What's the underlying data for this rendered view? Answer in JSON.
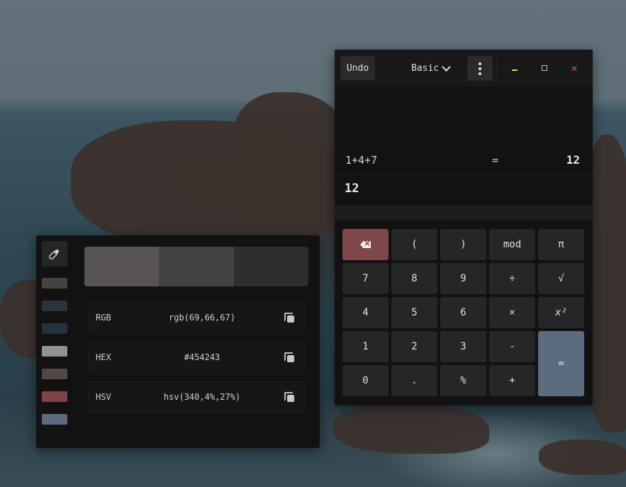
{
  "calculator": {
    "undo_label": "Undo",
    "mode_label": "Basic",
    "history": {
      "expression": "1+4+7",
      "equals": "=",
      "result": "12"
    },
    "current_value": "12",
    "keys": {
      "paren_open": "(",
      "paren_close": ")",
      "mod": "mod",
      "pi": "π",
      "seven": "7",
      "eight": "8",
      "nine": "9",
      "divide": "÷",
      "sqrt": "√",
      "four": "4",
      "five": "5",
      "six": "6",
      "multiply": "×",
      "square": "x²",
      "one": "1",
      "two": "2",
      "three": "3",
      "minus": "-",
      "equals": "=",
      "zero": "0",
      "dot": ".",
      "percent": "%",
      "plus": "+"
    },
    "icons": {
      "backspace": "backspace-icon",
      "menu": "kebab-menu-icon",
      "minimize": "minimize-icon",
      "maximize": "maximize-icon",
      "close": "close-icon",
      "dropdown": "chevron-down-icon"
    }
  },
  "picker": {
    "icons": {
      "eyedropper": "eyedropper-icon",
      "copy": "copy-icon"
    },
    "swatches": [
      "#454243",
      "#2a3340",
      "#26313b",
      "#8f9393",
      "#524844",
      "#7f4445",
      "#5c6b7d"
    ],
    "palette": [
      "#585454",
      "#454243",
      "#2f2d2d"
    ],
    "formats": [
      {
        "label": "RGB",
        "value": "rgb(69,66,67)"
      },
      {
        "label": "HEX",
        "value": "#454243"
      },
      {
        "label": "HSV",
        "value": "hsv(340,4%,27%)"
      }
    ]
  }
}
